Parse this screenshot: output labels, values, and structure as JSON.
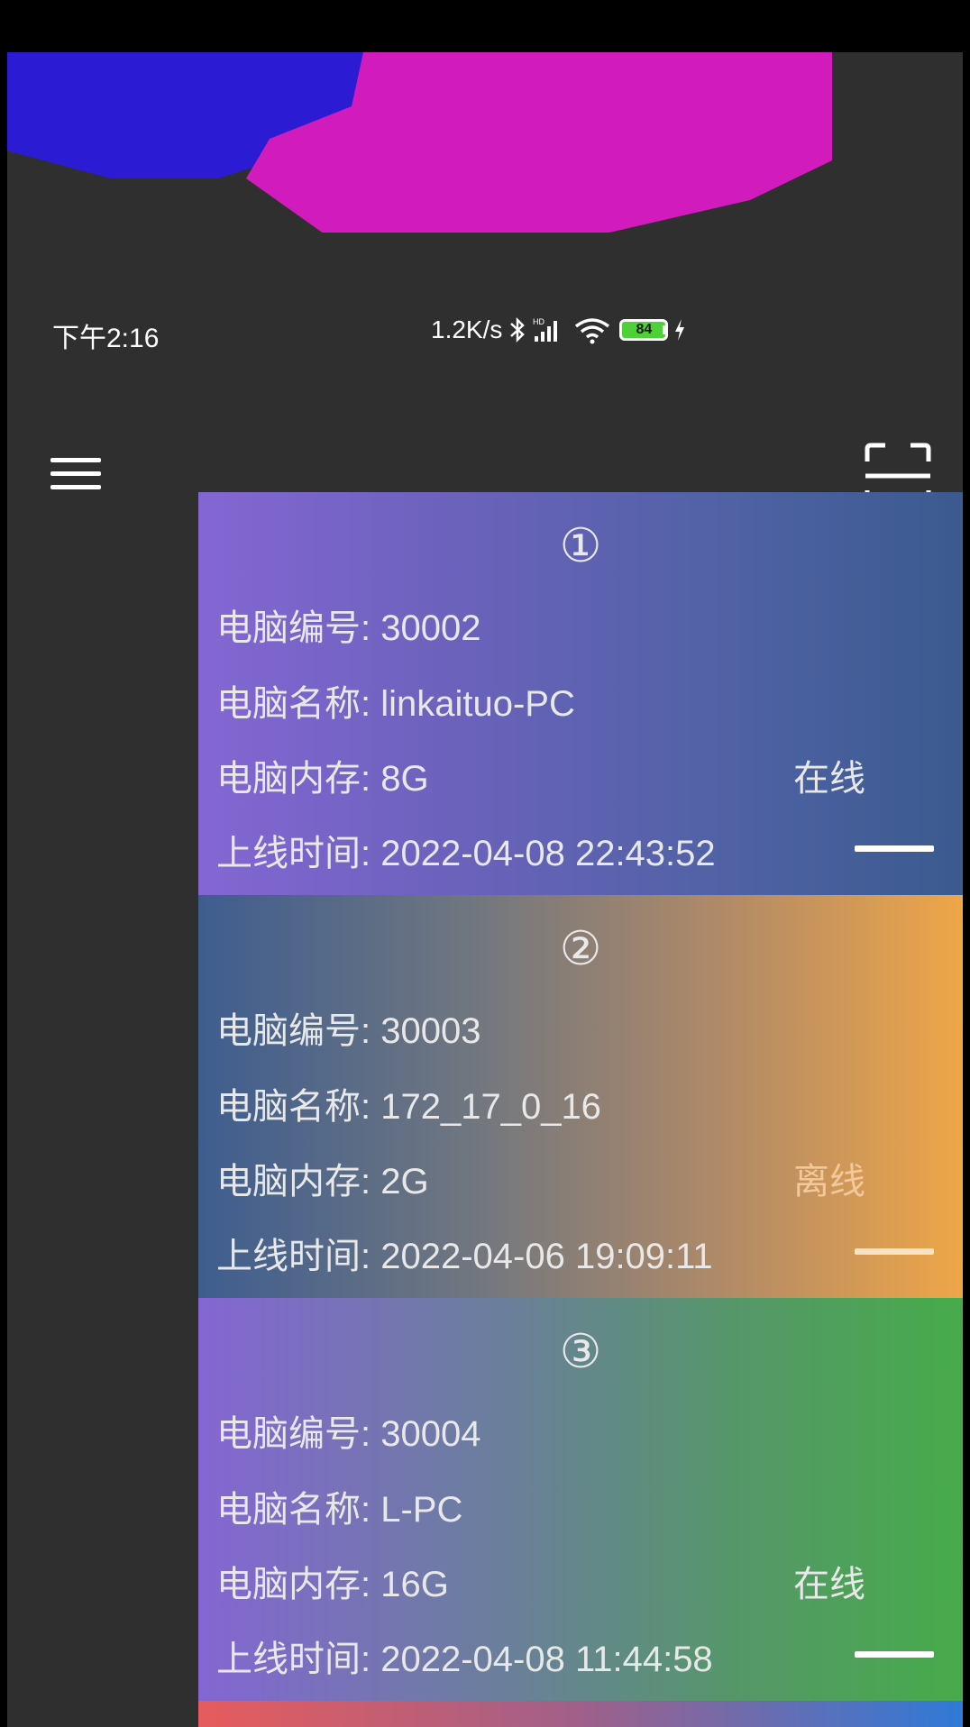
{
  "status_bar": {
    "time": "下午2:16",
    "net_speed": "1.2K/s",
    "battery": "84",
    "icons": [
      "bluetooth-icon",
      "hd-signal-icon",
      "wifi-icon",
      "battery-icon",
      "charging-icon"
    ]
  },
  "toolbar": {
    "menu_icon": "hamburger-menu-icon",
    "scan_icon": "scan-icon"
  },
  "computers": [
    {
      "index": "①",
      "number_label": "电脑编号: 30002",
      "name_label": "电脑名称: linkaituo-PC",
      "memory_label": "电脑内存: 8G",
      "online_time_label": "上线时间: 2022-04-08 22:43:52",
      "status": "在线"
    },
    {
      "index": "②",
      "number_label": "电脑编号: 30003",
      "name_label": "电脑名称: 172_17_0_16",
      "memory_label": "电脑内存: 2G",
      "online_time_label": "上线时间: 2022-04-06 19:09:11",
      "status": "离线"
    },
    {
      "index": "③",
      "number_label": "电脑编号: 30004",
      "name_label": "电脑名称: L-PC",
      "memory_label": "电脑内存: 16G",
      "online_time_label": "上线时间: 2022-04-08 11:44:58",
      "status": "在线"
    }
  ],
  "colors": {
    "background": "#2f2f2f",
    "card1_gradient": [
      "#8466d3",
      "#3b5a8f"
    ],
    "card2_gradient": [
      "#3e5d8f",
      "#eea648"
    ],
    "card3_gradient": [
      "#8466d3",
      "#46ab4a"
    ],
    "card4_gradient": [
      "#e65c5c",
      "#2f7ad8"
    ],
    "banner_blue": "#2b1bd2",
    "banner_magenta": "#d11bbd"
  }
}
